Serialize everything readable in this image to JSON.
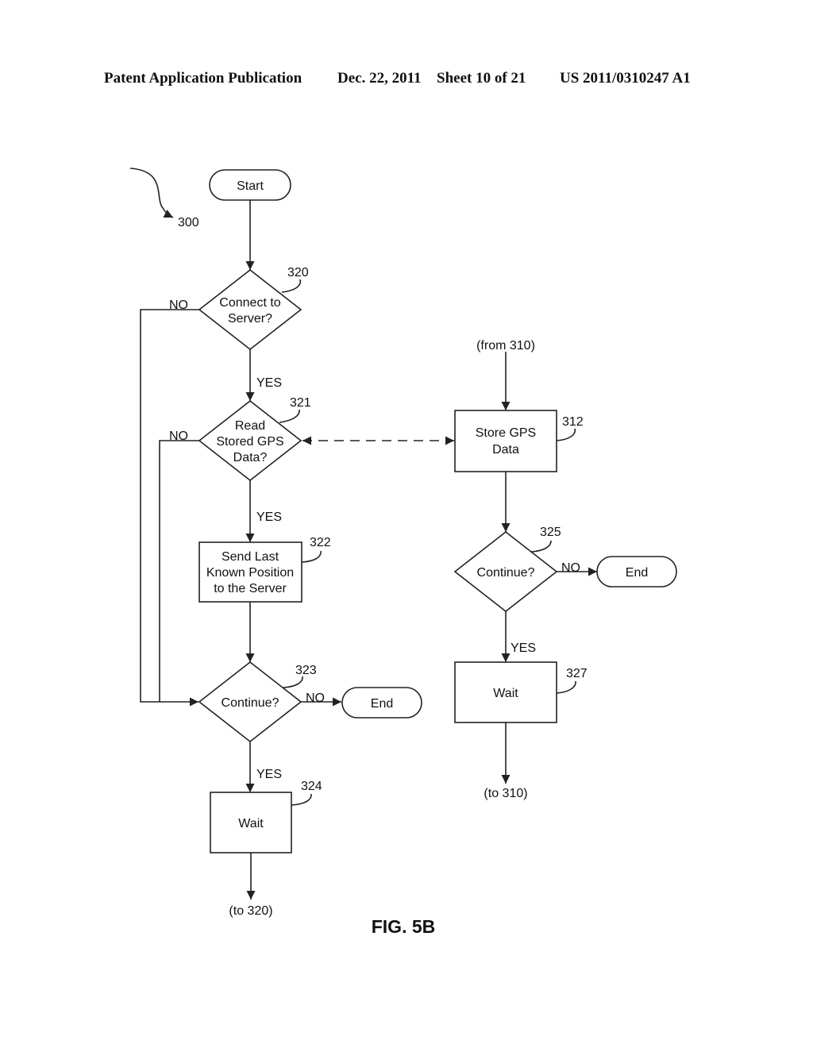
{
  "header": {
    "publication": "Patent Application Publication",
    "date": "Dec. 22, 2011",
    "sheet": "Sheet 10 of 21",
    "number": "US 2011/0310247 A1"
  },
  "diagram": {
    "ref_main": "300",
    "start_label": "Start",
    "nodes": {
      "n320": {
        "ref": "320",
        "lines": [
          "Connect to",
          "Server?"
        ]
      },
      "n321": {
        "ref": "321",
        "lines": [
          "Read",
          "Stored GPS",
          "Data?"
        ]
      },
      "n322": {
        "ref": "322",
        "lines": [
          "Send Last",
          "Known Position",
          "to the Server"
        ]
      },
      "n323": {
        "ref": "323",
        "lines": [
          "Continue?"
        ]
      },
      "n324": {
        "ref": "324",
        "lines": [
          "Wait"
        ]
      },
      "n312": {
        "ref": "312",
        "lines": [
          "Store GPS",
          "Data"
        ]
      },
      "n325": {
        "ref": "325",
        "lines": [
          "Continue?"
        ]
      },
      "n327": {
        "ref": "327",
        "lines": [
          "Wait"
        ]
      }
    },
    "end_label": "End",
    "yes": "YES",
    "no": "NO",
    "from_310": "(from 310)",
    "to_310": "(to 310)",
    "to_320": "(to 320)",
    "figure_label": "FIG. 5B"
  }
}
